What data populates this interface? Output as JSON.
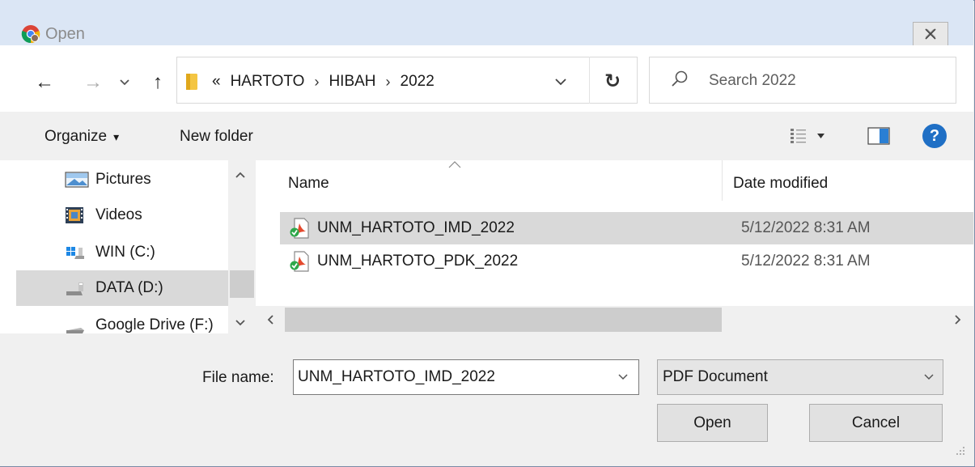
{
  "window": {
    "title": "Open",
    "close_glyph": "✕"
  },
  "navigation": {
    "back_glyph": "←",
    "forward_glyph": "→",
    "recent_glyph": "⌄",
    "up_glyph": "↑",
    "address": {
      "overflow": "«",
      "crumbs": [
        "HARTOTO",
        "HIBAH",
        "2022"
      ],
      "separator": "›"
    },
    "refresh_glyph": "↻",
    "search_placeholder": "Search 2022"
  },
  "toolbar": {
    "organize_label": "Organize",
    "organize_caret": "▾",
    "new_folder_label": "New folder",
    "help_label": "?"
  },
  "nav_pane": {
    "items": [
      {
        "label": "Pictures",
        "icon": "pictures-icon"
      },
      {
        "label": "Videos",
        "icon": "videos-icon"
      },
      {
        "label": "WIN (C:)",
        "icon": "windows-drive-icon"
      },
      {
        "label": "DATA (D:)",
        "icon": "drive-icon",
        "selected": true
      },
      {
        "label": "Google Drive (F:)",
        "icon": "drive-icon"
      }
    ]
  },
  "file_list": {
    "columns": {
      "name": "Name",
      "date": "Date modified"
    },
    "rows": [
      {
        "name": "UNM_HARTOTO_IMD_2022",
        "date": "5/12/2022 8:31 AM",
        "selected": true
      },
      {
        "name": "UNM_HARTOTO_PDK_2022",
        "date": "5/12/2022 8:31 AM"
      }
    ]
  },
  "bottom": {
    "filename_label": "File name:",
    "filename_value": "UNM_HARTOTO_IMD_2022",
    "filetype": "PDF Document",
    "open_label": "Open",
    "cancel_label": "Cancel"
  },
  "colors": {
    "title_bar": "#dbe6f5",
    "selection": "#d9d9d9",
    "help_blue": "#1f6fc5",
    "folder_yellow": "#f4c542"
  }
}
